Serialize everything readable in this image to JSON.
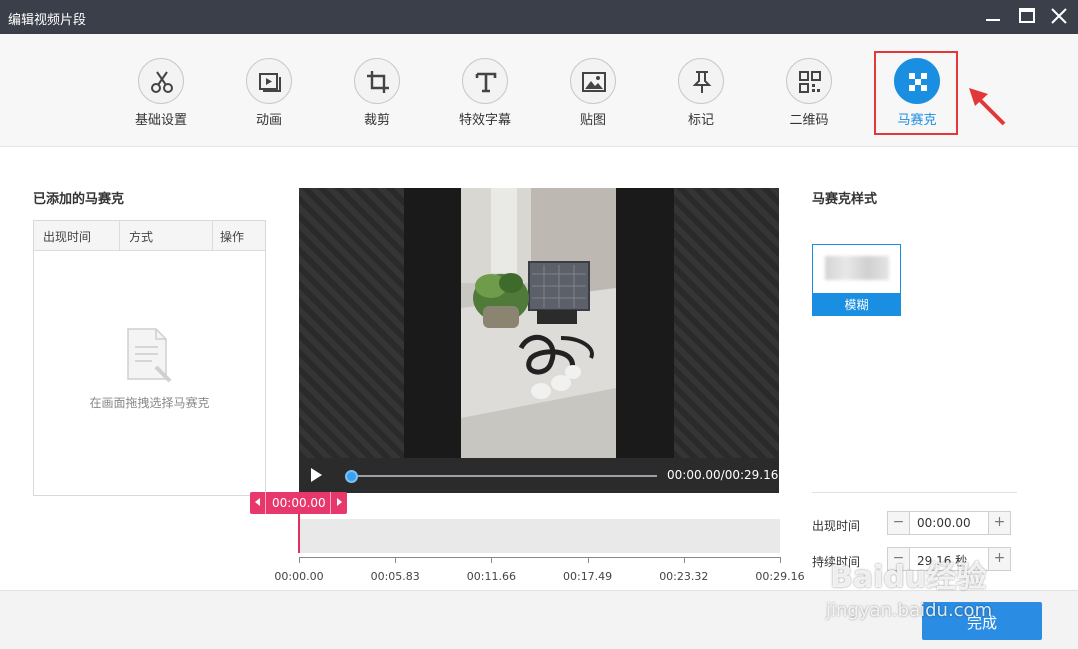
{
  "window": {
    "title": "编辑视频片段"
  },
  "toolbar": {
    "items": [
      {
        "label": "基础设置",
        "icon": "scissors-icon"
      },
      {
        "label": "动画",
        "icon": "play-frame-icon"
      },
      {
        "label": "裁剪",
        "icon": "crop-icon"
      },
      {
        "label": "特效字幕",
        "icon": "text-t-icon"
      },
      {
        "label": "贴图",
        "icon": "image-icon"
      },
      {
        "label": "标记",
        "icon": "pin-icon"
      },
      {
        "label": "二维码",
        "icon": "qrcode-icon"
      },
      {
        "label": "马赛克",
        "icon": "mosaic-icon",
        "active": true
      }
    ]
  },
  "left_panel": {
    "title": "已添加的马赛克",
    "columns": [
      "出现时间",
      "方式",
      "操作"
    ],
    "empty_text": "在画面拖拽选择马赛克"
  },
  "player": {
    "time_display": "00:00.00/00:29.16",
    "progress": 0.0
  },
  "timeline": {
    "current": "00:00.00",
    "ticks": [
      "00:00.00",
      "00:05.83",
      "00:11.66",
      "00:17.49",
      "00:23.32",
      "00:29.16"
    ]
  },
  "right_panel": {
    "title": "马赛克样式",
    "style_option": "模糊",
    "start_label": "出现时间",
    "start_value": "00:00.00",
    "duration_label": "持续时间",
    "duration_value": "29.16 秒"
  },
  "footer": {
    "done_label": "完成"
  },
  "watermark": {
    "brand": "Baidu经验",
    "url": "jingyan.baidu.com"
  },
  "colors": {
    "accent": "#1a8ee0",
    "highlight": "#e2383a",
    "timeline_marker": "#e8376b",
    "titlebar": "#3a3f49"
  }
}
